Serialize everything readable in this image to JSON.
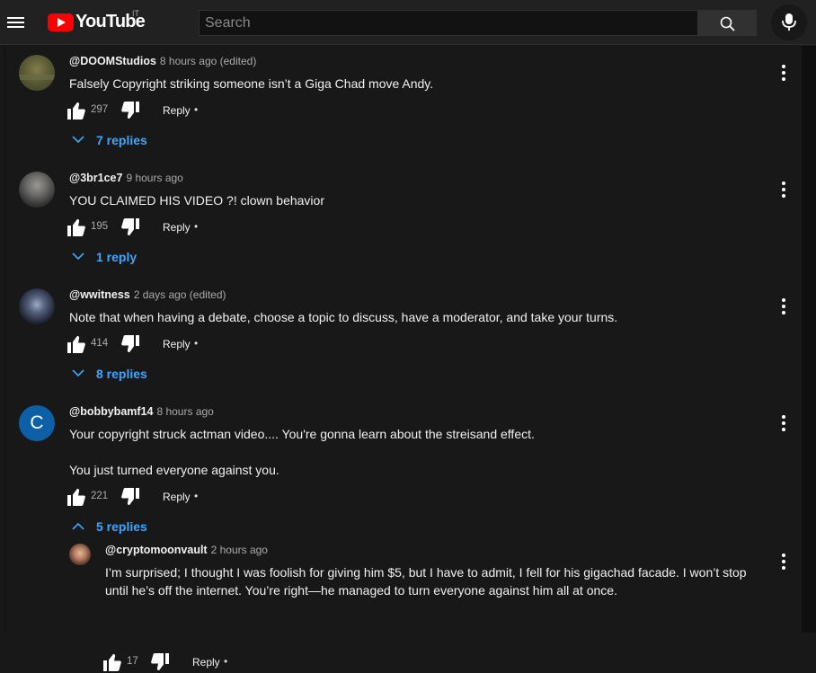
{
  "header": {
    "logo_text": "YouTube",
    "country_code": "IT",
    "search_placeholder": "Search"
  },
  "colors": {
    "accent_link": "#3ea6ff",
    "brand_red": "#ff0000",
    "background": "#181818"
  },
  "comments": [
    {
      "author": "@DOOMStudios",
      "time": "8 hours ago (edited)",
      "text": "Falsely Copyright striking someone isn’t a Giga Chad move Andy.",
      "likes": "297",
      "reply_label": "Reply",
      "dot": "•",
      "replies_label": "7 replies",
      "avatar_icon": "landscape-photo-avatar"
    },
    {
      "author": "@3br1ce7",
      "time": "9 hours ago",
      "text": "YOU CLAIMED HIS VIDEO ?! clown behavior",
      "likes": "195",
      "reply_label": "Reply",
      "dot": "•",
      "replies_label": "1 reply",
      "avatar_icon": "person-photo-avatar"
    },
    {
      "author": "@wwitness",
      "time": "2 days ago (edited)",
      "text": "Note that when having a debate, choose a topic to discuss, have a moderator, and take your turns.",
      "likes": "414",
      "reply_label": "Reply",
      "dot": "•",
      "replies_label": "8 replies",
      "avatar_icon": "hooded-figure-avatar"
    },
    {
      "author": "@bobbybamf14",
      "time": "8 hours ago",
      "text": "Your copyright struck actman video....  You're gonna learn about the streisand effect.\n\nYou just turned everyone against you.",
      "likes": "221",
      "reply_label": "Reply",
      "dot": "•",
      "replies_label": "5 replies",
      "avatar_letter": "C",
      "avatar_color": "#0d5fa6"
    }
  ],
  "reply": {
    "author": "@cryptomoonvault",
    "time": "2 hours ago",
    "text": "I’m surprised; I thought I was foolish for giving him $5, but I have to admit, I fell for his gigachad facade. I won’t stop\nuntil he’s off the internet. You’re right—he managed to turn everyone against him all at once.",
    "likes": "17",
    "reply_label": "Reply",
    "dot": "•",
    "avatar_icon": "bearded-man-avatar"
  }
}
